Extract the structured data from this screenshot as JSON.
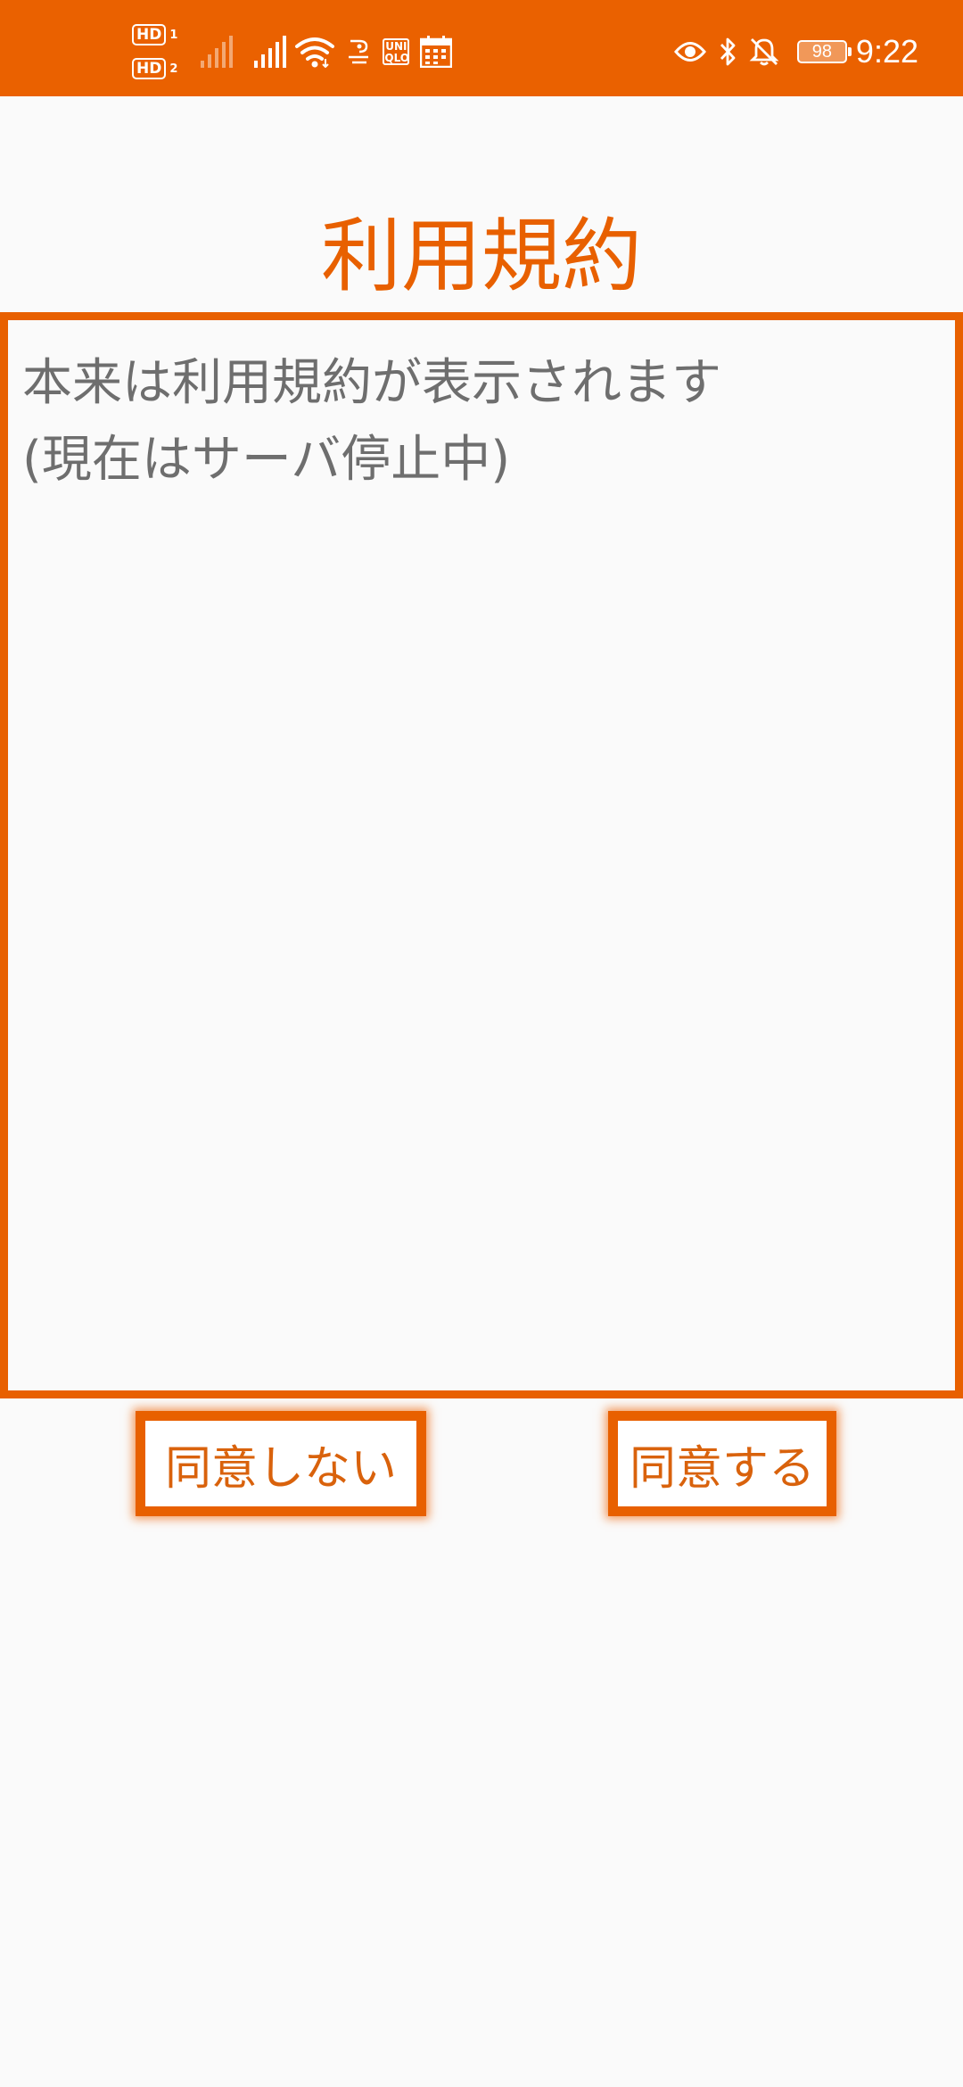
{
  "status_bar": {
    "sim_badges": [
      {
        "label": "HD",
        "slot": "1"
      },
      {
        "label": "HD",
        "slot": "2"
      }
    ],
    "uniqlo_icon_text": "UNI QLO",
    "battery_level": "98",
    "time": "9:22",
    "icons": [
      "signal-weak-icon",
      "signal-icon",
      "wifi-icon",
      "nfc-icon",
      "uniqlo-icon",
      "calendar-icon",
      "eye-icon",
      "bluetooth-icon",
      "bell-off-icon",
      "battery-icon"
    ]
  },
  "page": {
    "title": "利用規約",
    "body_line1": "本来は利用規約が表示されます",
    "body_line2": "(現在はサーバ停止中)"
  },
  "buttons": {
    "disagree_label": "同意しない",
    "agree_label": "同意する"
  },
  "colors": {
    "accent": "#e86000",
    "status_bar": "#ea6100",
    "body_text": "#6e6e6e",
    "background": "#fafafa"
  }
}
